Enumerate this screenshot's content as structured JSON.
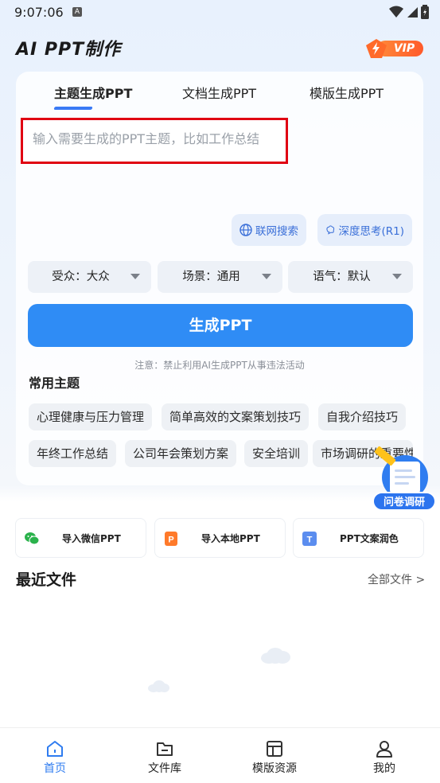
{
  "status_bar": {
    "time": "9:07:06",
    "notification_letter": "A"
  },
  "header": {
    "title": "AI PPT制作",
    "vip_label": "VIP"
  },
  "tabs": [
    {
      "label": "主题生成PPT",
      "active": true
    },
    {
      "label": "文档生成PPT",
      "active": false
    },
    {
      "label": "模版生成PPT",
      "active": false
    }
  ],
  "prompt": {
    "placeholder": "输入需要生成的PPT主题，比如工作总结"
  },
  "chips": {
    "web_search": "联网搜索",
    "deep_think": "深度思考(R1)"
  },
  "selects": {
    "audience": "受众：大众",
    "scene": "场景：通用",
    "tone": "语气：默认"
  },
  "generate_button": "生成PPT",
  "notice": "注意：禁止利用AI生成PPT从事违法活动",
  "common_topics": {
    "title": "常用主题",
    "items": [
      "心理健康与压力管理",
      "简单高效的文案策划技巧",
      "自我介绍技巧",
      "年终工作总结",
      "公司年会策划方案",
      "安全培训",
      "市场调研的重要性"
    ]
  },
  "survey_label": "问卷调研",
  "imports": {
    "wechat": "导入微信PPT",
    "local": "导入本地PPT",
    "polish": "PPT文案润色"
  },
  "recent": {
    "title": "最近文件",
    "all_label": "全部文件 >"
  },
  "bottom_nav": [
    {
      "label": "首页",
      "active": true
    },
    {
      "label": "文件库",
      "active": false
    },
    {
      "label": "模版资源",
      "active": false
    },
    {
      "label": "我的",
      "active": false
    }
  ],
  "colors": {
    "accent": "#2f8cf5",
    "vip_orange": "#ff6a2a",
    "highlight_red": "#e00012"
  }
}
